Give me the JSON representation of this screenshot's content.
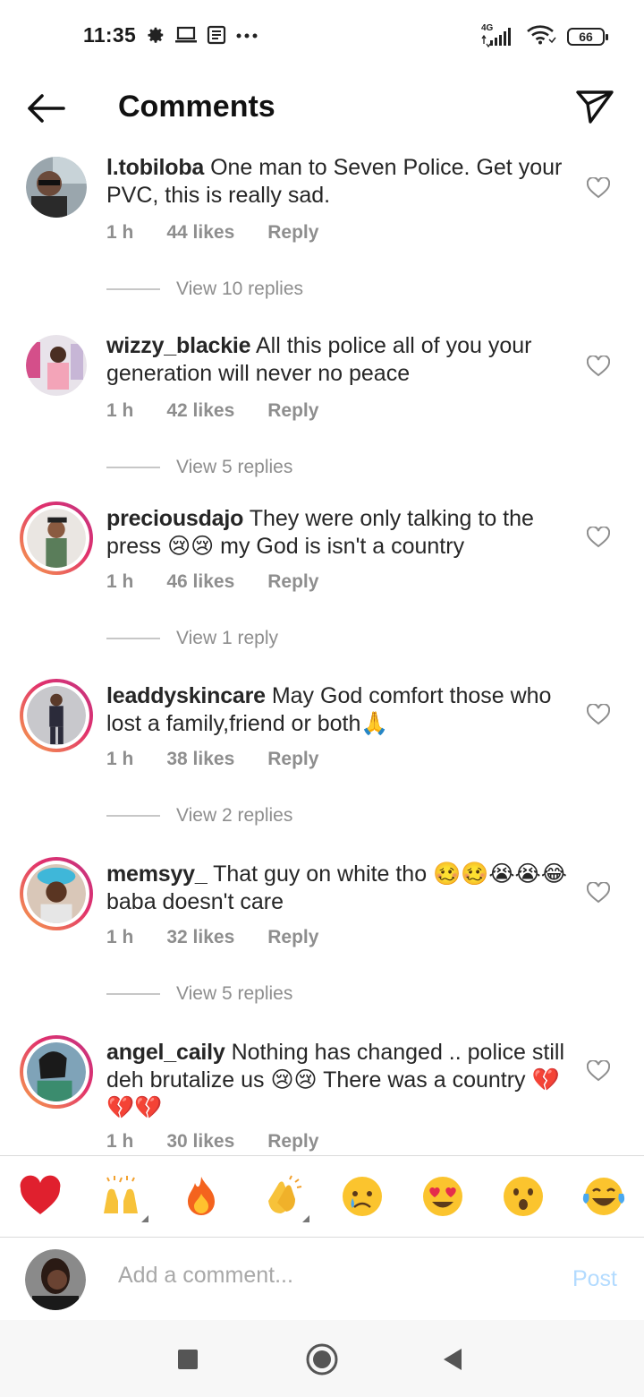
{
  "status_bar": {
    "time": "11:35",
    "network": "4G",
    "battery": "66",
    "left_icons": [
      "gear-icon",
      "laptop-icon",
      "news-icon",
      "more-dots-icon"
    ],
    "right_icons": [
      "signal-icon",
      "wifi-icon",
      "battery-icon"
    ]
  },
  "header": {
    "title": "Comments",
    "back_icon": "arrow-left-icon",
    "share_icon": "paper-plane-icon"
  },
  "comments": [
    {
      "username": "l.tobiloba",
      "text": "One man to Seven Police. Get your PVC, this is really sad.",
      "time": "1 h",
      "likes": "44 likes",
      "reply": "Reply",
      "view_replies": "View 10 replies",
      "story_ring": false
    },
    {
      "username": "wizzy_blackie",
      "text": "All this police all of you your generation will never no peace",
      "time": "1 h",
      "likes": "42 likes",
      "reply": "Reply",
      "view_replies": "View 5 replies",
      "story_ring": false
    },
    {
      "username": "preciousdajo",
      "text": "They were only talking to the press 😢😢 my God is isn't a country",
      "time": "1 h",
      "likes": "46 likes",
      "reply": "Reply",
      "view_replies": "View 1 reply",
      "story_ring": true
    },
    {
      "username": "leaddyskincare",
      "text": "May God comfort those who lost a family,friend or both🙏",
      "time": "1 h",
      "likes": "38 likes",
      "reply": "Reply",
      "view_replies": "View 2 replies",
      "story_ring": true
    },
    {
      "username": "memsyy_",
      "text": "That guy on white tho 🥴🥴😭😭😂baba doesn't care",
      "time": "1 h",
      "likes": "32 likes",
      "reply": "Reply",
      "view_replies": "View 5 replies",
      "story_ring": true
    },
    {
      "username": "angel_caily",
      "text": "Nothing has changed .. police still deh brutalize us 😢😢 There was a country 💔💔💔",
      "time": "1 h",
      "likes": "30 likes",
      "reply": "Reply",
      "view_replies": "",
      "story_ring": true
    }
  ],
  "emoji_bar": [
    "red-heart",
    "raising-hands",
    "fire",
    "clapping-hands",
    "crying-face",
    "heart-eyes",
    "surprised-face",
    "tears-of-joy"
  ],
  "composer": {
    "placeholder": "Add a comment...",
    "post_label": "Post"
  },
  "colors": {
    "text": "#262626",
    "secondary": "#8e8e8e",
    "post_disabled": "#b3dbff",
    "story_ring": "#e1306c"
  }
}
